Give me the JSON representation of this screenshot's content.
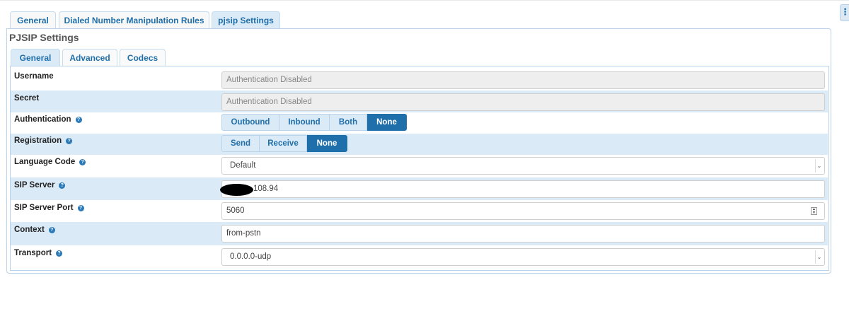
{
  "outer_tabs": [
    {
      "label": "General"
    },
    {
      "label": "Dialed Number Manipulation Rules"
    },
    {
      "label": "pjsip Settings"
    }
  ],
  "panel_title": "PJSIP Settings",
  "inner_tabs": [
    {
      "label": "General"
    },
    {
      "label": "Advanced"
    },
    {
      "label": "Codecs"
    }
  ],
  "fields": {
    "username": {
      "label": "Username",
      "placeholder": "Authentication Disabled"
    },
    "secret": {
      "label": "Secret",
      "placeholder": "Authentication Disabled"
    },
    "authentication": {
      "label": "Authentication",
      "options": [
        "Outbound",
        "Inbound",
        "Both",
        "None"
      ],
      "selected": "None"
    },
    "registration": {
      "label": "Registration",
      "options": [
        "Send",
        "Receive",
        "None"
      ],
      "selected": "None"
    },
    "language_code": {
      "label": "Language Code",
      "value": "Default"
    },
    "sip_server": {
      "label": "SIP Server",
      "value": "108.94"
    },
    "sip_server_port": {
      "label": "SIP Server Port",
      "value": "5060"
    },
    "context": {
      "label": "Context",
      "value": "from-pstn"
    },
    "transport": {
      "label": "Transport",
      "value": "0.0.0.0-udp"
    }
  },
  "icons": {
    "help": "question-circle-icon",
    "menu": "vertical-ellipsis-icon",
    "caret": "chevron-down-icon"
  },
  "colors": {
    "accent": "#1f6fab",
    "row_shade": "#dbeaf7"
  }
}
